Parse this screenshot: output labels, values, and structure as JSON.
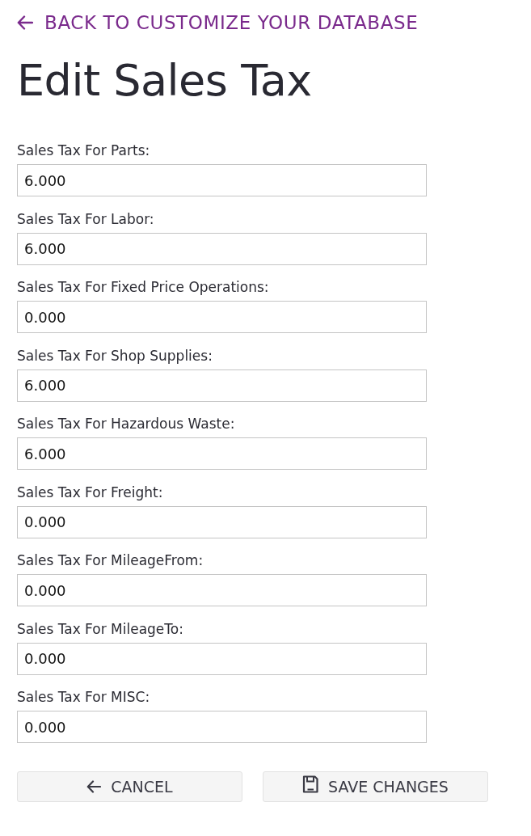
{
  "back_link": {
    "label": "BACK TO CUSTOMIZE YOUR DATABASE"
  },
  "title": "Edit Sales Tax",
  "fields": [
    {
      "label": "Sales Tax For Parts:",
      "value": "6.000"
    },
    {
      "label": "Sales Tax For Labor:",
      "value": "6.000"
    },
    {
      "label": "Sales Tax For Fixed Price Operations:",
      "value": "0.000"
    },
    {
      "label": "Sales Tax For Shop Supplies:",
      "value": "6.000"
    },
    {
      "label": "Sales Tax For Hazardous Waste:",
      "value": "6.000"
    },
    {
      "label": "Sales Tax For Freight:",
      "value": "0.000"
    },
    {
      "label": "Sales Tax For MileageFrom:",
      "value": "0.000"
    },
    {
      "label": "Sales Tax For MileageTo:",
      "value": "0.000"
    },
    {
      "label": "Sales Tax For MISC:",
      "value": "0.000"
    }
  ],
  "buttons": [
    {
      "label": "CANCEL",
      "kind": "cancel"
    },
    {
      "label": "SAVE CHANGES",
      "kind": "save"
    }
  ]
}
